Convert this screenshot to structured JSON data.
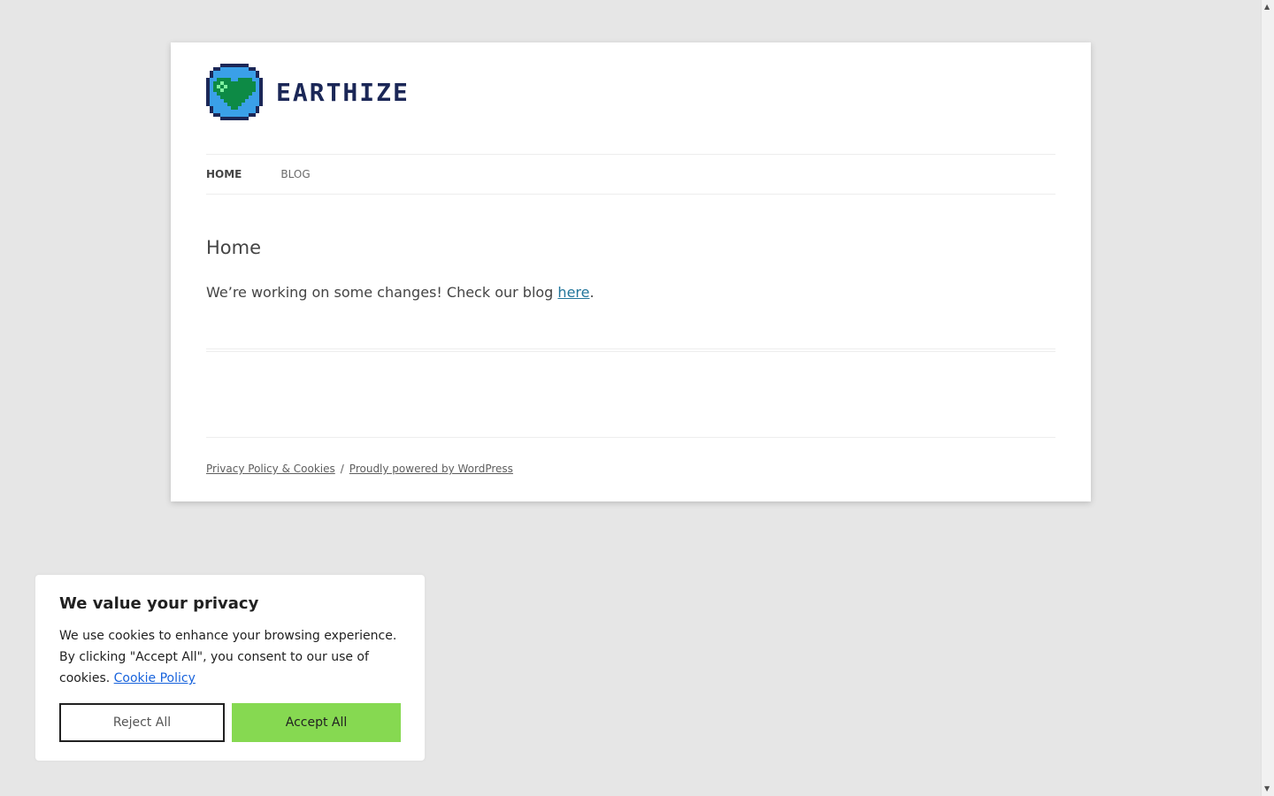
{
  "site": {
    "brand": "EARTHIZE",
    "nav": [
      {
        "label": "HOME",
        "current": true
      },
      {
        "label": "BLOG",
        "current": false
      }
    ]
  },
  "content": {
    "title": "Home",
    "text_before": "We’re working on some changes! Check our blog ",
    "link_text": "here",
    "text_after": "."
  },
  "footer": {
    "privacy_link": "Privacy Policy & Cookies",
    "separator": "/",
    "powered_link": "Proudly powered by WordPress"
  },
  "cookie_banner": {
    "title": "We value your privacy",
    "text": "We use cookies to enhance your browsing experience. By clicking \"Accept All\", you consent to our use of cookies.",
    "policy_link": "Cookie Policy",
    "reject_label": "Reject All",
    "accept_label": "Accept All"
  },
  "icons": {
    "logo": "earth-heart-logo-icon",
    "scroll_up": "scroll-up-arrow-icon",
    "scroll_down": "scroll-down-arrow-icon"
  },
  "colors": {
    "background": "#e6e6e6",
    "brand": "#1b2757",
    "link": "#21759b",
    "accept_button": "#86d951",
    "cookie_link": "#1863dc"
  }
}
